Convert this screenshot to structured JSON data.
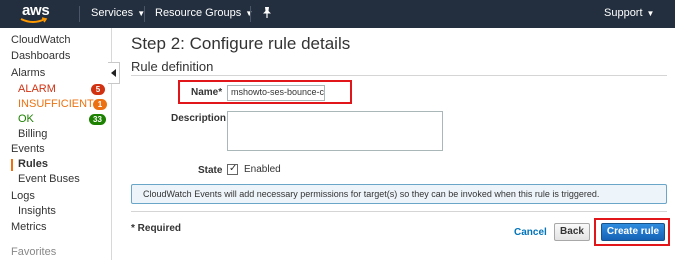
{
  "topnav": {
    "logo_text": "aws",
    "services_label": "Services",
    "resource_groups_label": "Resource Groups",
    "support_label": "Support",
    "bg_color": "#232f3e"
  },
  "sidebar": {
    "items": [
      {
        "label": "CloudWatch"
      },
      {
        "label": "Dashboards"
      },
      {
        "label": "Alarms"
      },
      {
        "label": "ALARM",
        "badge": "5"
      },
      {
        "label": "INSUFFICIENT",
        "badge": "1"
      },
      {
        "label": "OK",
        "badge": "33"
      },
      {
        "label": "Billing"
      },
      {
        "label": "Events"
      },
      {
        "label": "Rules"
      },
      {
        "label": "Event Buses"
      },
      {
        "label": "Logs"
      },
      {
        "label": "Insights"
      },
      {
        "label": "Metrics"
      },
      {
        "label": "Favorites"
      }
    ],
    "active_item": "Rules",
    "accent_color": "#ec7211"
  },
  "main": {
    "page_title": "Step 2: Configure rule details",
    "section_title": "Rule definition",
    "name_label": "Name*",
    "name_value": "mshowto-ses-bounce-co",
    "description_label": "Description",
    "description_value": "",
    "state_label": "State",
    "state_value": "Enabled",
    "state_checked": true,
    "info_text": "CloudWatch Events will add necessary permissions for target(s) so they can be invoked when this rule is triggered.",
    "required_note": "* Required",
    "cancel_label": "Cancel",
    "back_label": "Back",
    "create_label": "Create rule",
    "highlight_color": "#e0161a",
    "primary_color": "#1a6ec4"
  }
}
